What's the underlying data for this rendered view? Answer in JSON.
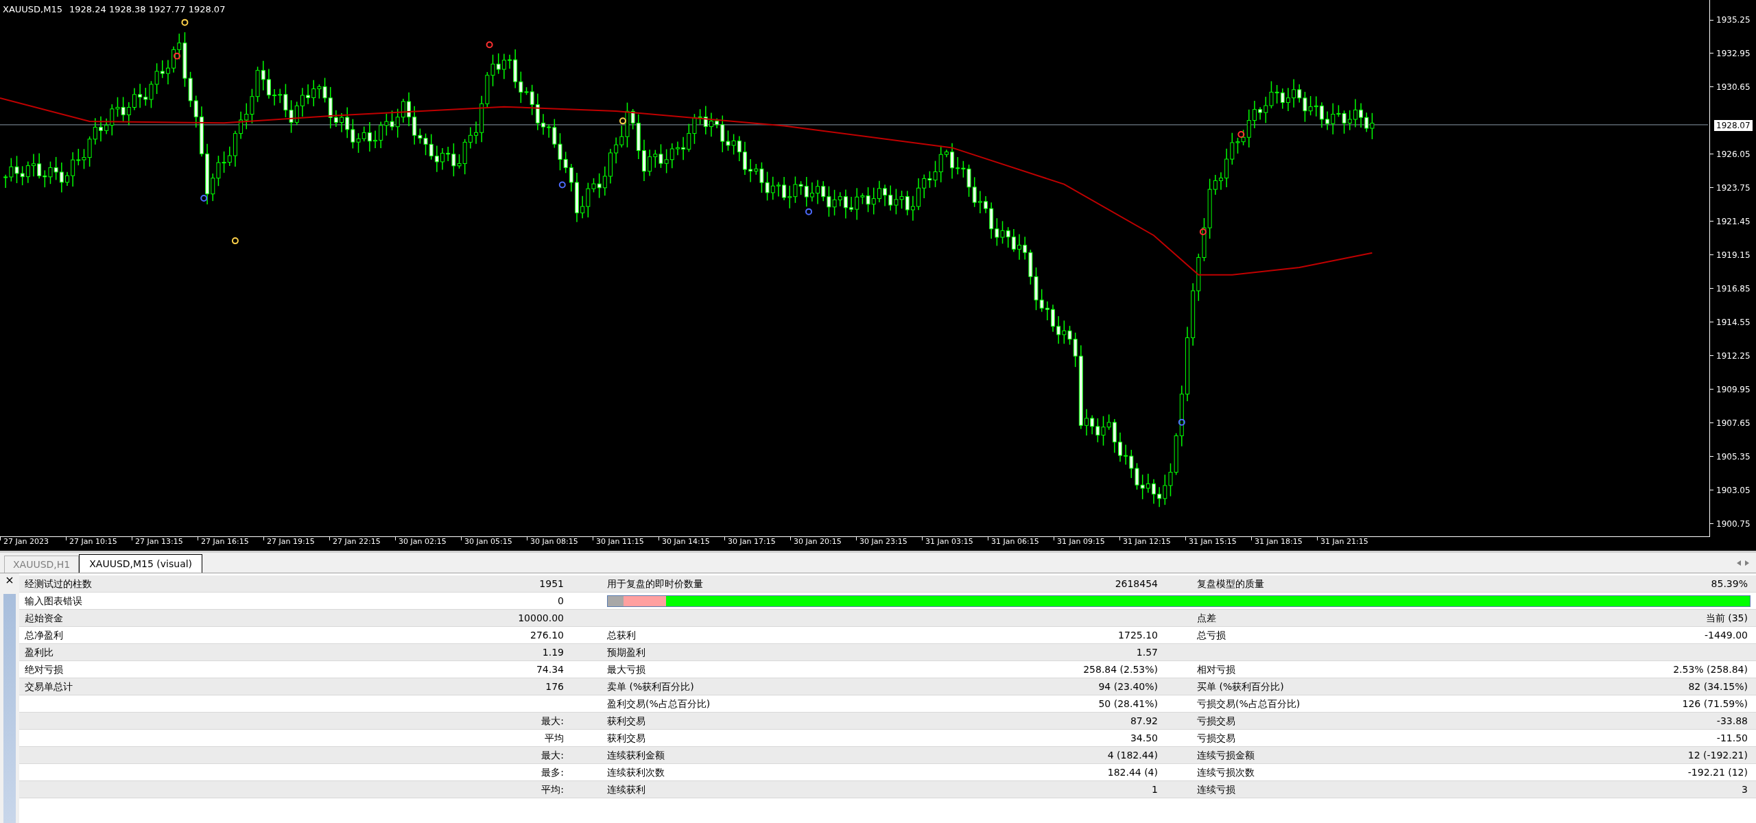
{
  "chart": {
    "symbol": "XAUUSD,M15",
    "quote": "1928.24 1928.38 1927.77 1928.07",
    "price_label": "1928.07",
    "y_ticks": [
      "1935.25",
      "1932.95",
      "1930.65",
      "1926.05",
      "1923.75",
      "1921.45",
      "1919.15",
      "1916.85",
      "1914.55",
      "1912.25",
      "1909.95",
      "1907.65",
      "1905.35",
      "1903.05",
      "1900.75"
    ],
    "x_ticks": [
      "27 Jan 2023",
      "27 Jan 10:15",
      "27 Jan 13:15",
      "27 Jan 16:15",
      "27 Jan 19:15",
      "27 Jan 22:15",
      "30 Jan 02:15",
      "30 Jan 05:15",
      "30 Jan 08:15",
      "30 Jan 11:15",
      "30 Jan 14:15",
      "30 Jan 17:15",
      "30 Jan 20:15",
      "30 Jan 23:15",
      "31 Jan 03:15",
      "31 Jan 06:15",
      "31 Jan 09:15",
      "31 Jan 12:15",
      "31 Jan 15:15",
      "31 Jan 18:15",
      "31 Jan 21:15"
    ]
  },
  "tabs": [
    {
      "label": "XAUUSD,H1",
      "selected": false
    },
    {
      "label": "XAUUSD,M15 (visual)",
      "selected": true
    }
  ],
  "panel_close": "×",
  "rows": [
    {
      "kind": "text",
      "label_1": "经测试过的柱数",
      "value_1": "1951",
      "label_2": "用于复盘的即时价数量",
      "value_2": "2618454",
      "label_3": "复盘模型的质量",
      "value_3": "85.39%"
    },
    {
      "kind": "bar",
      "label_1": "输入图表错误",
      "value_1": "0",
      "bar": {
        "color": "#00ff00",
        "segments": [
          {
            "color": "#a8a8a8",
            "level": 0.014
          },
          {
            "color": "#ffa0a0",
            "level": 0.051
          }
        ]
      }
    },
    {
      "kind": "text",
      "label_1": "起始资金",
      "value_1": "10000.00",
      "label_3": "点差",
      "value_3": "当前 (35)"
    },
    {
      "kind": "text",
      "label_1": "总净盈利",
      "value_1": "276.10",
      "label_2": "总获利",
      "value_2": "1725.10",
      "label_3": "总亏损",
      "value_3": "-1449.00"
    },
    {
      "kind": "text",
      "label_1": "盈利比",
      "value_1": "1.19",
      "label_2": "预期盈利",
      "value_2": "1.57"
    },
    {
      "kind": "text",
      "label_1": "绝对亏损",
      "value_1": "74.34",
      "label_2": "最大亏损",
      "value_2": "258.84 (2.53%)",
      "label_3": "相对亏损",
      "value_3": "2.53% (258.84)"
    },
    {
      "kind": "text",
      "label_1": "交易单总计",
      "value_1": "176",
      "label_2": "卖单 (%获利百分比)",
      "value_2": "94 (23.40%)",
      "label_3": "买单 (%获利百分比)",
      "value_3": "82 (34.15%)"
    },
    {
      "kind": "text",
      "label_2": "盈利交易(%占总百分比)",
      "value_2": "50 (28.41%)",
      "label_3": "亏损交易(%占总百分比)",
      "value_3": "126 (71.59%)"
    },
    {
      "kind": "text",
      "value_1": "最大:",
      "label_2": "获利交易",
      "value_2": "87.92",
      "label_3": "亏损交易",
      "value_3": "-33.88"
    },
    {
      "kind": "text",
      "value_1": "平均",
      "label_2": "获利交易",
      "value_2": "34.50",
      "label_3": "亏损交易",
      "value_3": "-11.50"
    },
    {
      "kind": "text",
      "value_1": "最大:",
      "label_2": "连续获利金额",
      "value_2": "4 (182.44)",
      "label_3": "连续亏损金额",
      "value_3": "12 (-192.21)"
    },
    {
      "kind": "text",
      "value_1": "最多:",
      "label_2": "连续获利次数",
      "value_2": "182.44 (4)",
      "label_3": "连续亏损次数",
      "value_3": "-192.21 (12)"
    },
    {
      "kind": "text",
      "value_1": "平均:",
      "label_2": "连续获利",
      "value_2": "1",
      "label_3": "连续亏损",
      "value_3": "3"
    }
  ]
}
